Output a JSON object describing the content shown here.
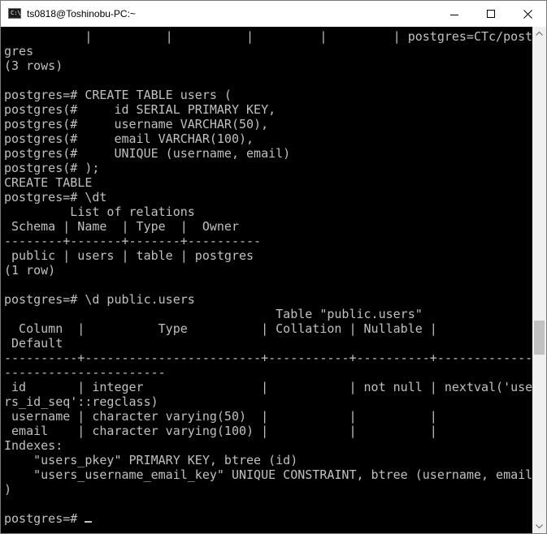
{
  "window": {
    "title": "ts0818@Toshinobu-PC:~",
    "icon": "console-icon",
    "icon_glyph": "C:\\"
  },
  "controls": {
    "minimize": "minimize-icon",
    "maximize": "maximize-icon",
    "close": "close-icon"
  },
  "console": {
    "lines": [
      "           |          |          |         |         | postgres=CTc/post",
      "gres",
      "(3 rows)",
      "",
      "postgres=# CREATE TABLE users (",
      "postgres(#     id SERIAL PRIMARY KEY,",
      "postgres(#     username VARCHAR(50),",
      "postgres(#     email VARCHAR(100),",
      "postgres(#     UNIQUE (username, email)",
      "postgres(# );",
      "CREATE TABLE",
      "postgres=# \\dt",
      "         List of relations",
      " Schema | Name  | Type  |  Owner",
      "--------+-------+-------+----------",
      " public | users | table | postgres",
      "(1 row)",
      "",
      "postgres=# \\d public.users",
      "                                     Table \"public.users\"",
      "  Column  |          Type          | Collation | Nullable |",
      " Default",
      "----------+------------------------+-----------+----------+-------------",
      "----------------------",
      " id       | integer                |           | not null | nextval('use",
      "rs_id_seq'::regclass)",
      " username | character varying(50)  |           |          |",
      " email    | character varying(100) |           |          |",
      "Indexes:",
      "    \"users_pkey\" PRIMARY KEY, btree (id)",
      "    \"users_username_email_key\" UNIQUE CONSTRAINT, btree (username, email",
      ")",
      "",
      "postgres=# "
    ]
  },
  "scrollbar": {
    "position_fraction": 0.63
  }
}
